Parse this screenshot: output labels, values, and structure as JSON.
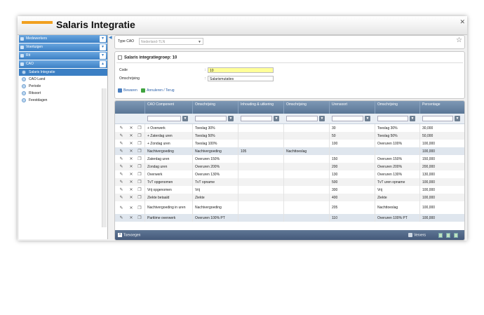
{
  "window": {
    "title": "Salaris Integratie",
    "close_icon": "✕"
  },
  "sidebar": {
    "sections": [
      {
        "label": "Medewerkers",
        "icon": "chevron-down-icon"
      },
      {
        "label": "Voertuigen",
        "icon": "chevron-down-icon"
      },
      {
        "label": "Rit",
        "icon": "chevron-down-icon"
      },
      {
        "label": "CAO",
        "icon": "chevron-up-icon"
      }
    ],
    "cao_items": [
      "Salaris Integratie",
      "CAO Land",
      "Periode",
      "Ritsoort",
      "Feestdagen"
    ],
    "active_item": "Salaris Integratie"
  },
  "topbar": {
    "type_label": "Type CAO",
    "type_value": "Nederland-TLN",
    "star": "☆"
  },
  "form": {
    "title": "Salaris integratiegroep: 10",
    "code_label": "Code",
    "code_value": "10",
    "omschrijving_label": "Omschrijving",
    "omschrijving_value": "Salarismutaties",
    "save_label": "Bewaren",
    "cancel_label": "Annuleren / Terug"
  },
  "grid": {
    "columns": [
      "CAO Component",
      "Omschrijving",
      "Inhouding & uitkering",
      "Omschrijving",
      "Urensoort",
      "Omschrijving",
      "Percentage"
    ],
    "rows": [
      [
        "+ Overwerk",
        "Toeslag 30%",
        "",
        "",
        "30",
        "Toeslag 30%",
        "30,000"
      ],
      [
        "+ Zaterdag uren",
        "Toeslag 50%",
        "",
        "",
        "50",
        "Toeslag 50%",
        "50,000"
      ],
      [
        "+ Zondag uren",
        "Toeslag 100%",
        "",
        "",
        "100",
        "Overuren 100%",
        "100,000"
      ],
      [
        "Nachtvergoeding",
        "Nachtvergoeding",
        "105",
        "Nachttoeslag",
        "",
        "",
        "100,000"
      ],
      [
        "Zaterdag uren",
        "Overuren 150%",
        "",
        "",
        "150",
        "Overuren 150%",
        "150,000"
      ],
      [
        "Zondag uren",
        "Overuren 200%",
        "",
        "",
        "200",
        "Overuren 200%",
        "200,000"
      ],
      [
        "Overwerk",
        "Overuren 130%",
        "",
        "",
        "130",
        "Overuren 130%",
        "130,000"
      ],
      [
        "TvT opgenomen",
        "TvT opname",
        "",
        "",
        "500",
        "TvT uren opname",
        "100,000"
      ],
      [
        "Vrij opgenomen",
        "Vrij",
        "",
        "",
        "300",
        "Vrij",
        "100,000"
      ],
      [
        "Ziekte betaald",
        "Ziekte",
        "",
        "",
        "400",
        "Ziekte",
        "100,000"
      ],
      [
        "Nachtvergoeding in uren",
        "Nachtvergoeding",
        "",
        "",
        "205",
        "Nachttoeslag",
        "100,000"
      ],
      [
        "Parttime overwerk",
        "Overuren 100% PT",
        "",
        "",
        "110",
        "Overuren 100% PT",
        "100,000"
      ]
    ],
    "add_label": "Toevoegen",
    "refresh_label": "Ververs",
    "filter_icon": "▼",
    "edit_icon": "✎",
    "delete_icon": "✕"
  }
}
